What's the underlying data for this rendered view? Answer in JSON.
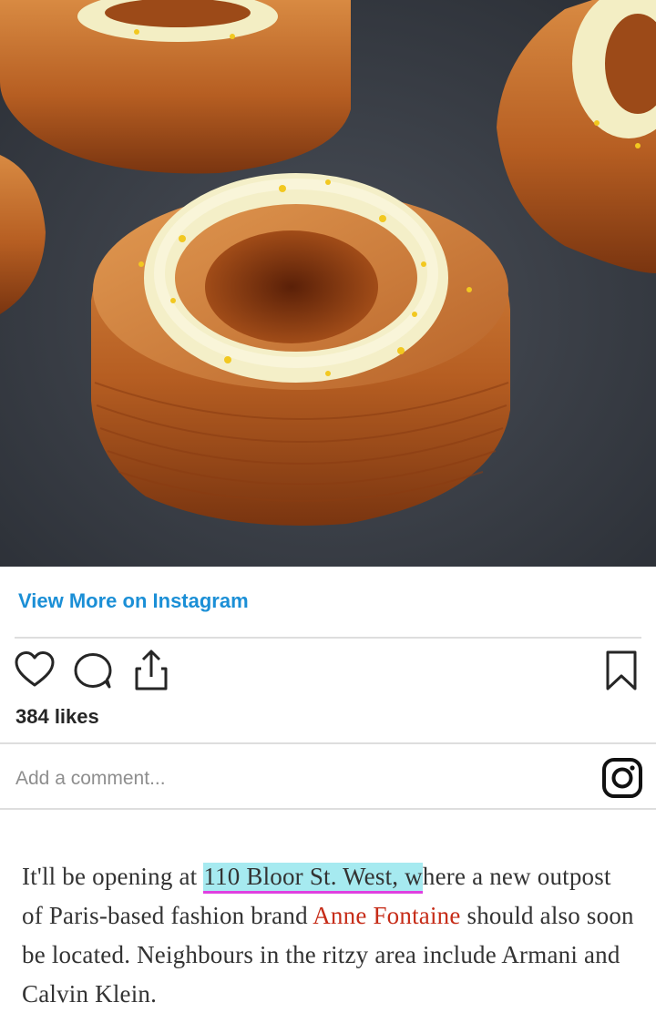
{
  "post": {
    "image_name": "cruffin-pastry-photo",
    "view_more_label": "View More on Instagram",
    "likes": "384 likes",
    "comment_placeholder": "Add a comment..."
  },
  "icons": {
    "like": "heart-icon",
    "comment": "comment-bubble-icon",
    "share": "share-upload-icon",
    "save": "bookmark-icon",
    "instagram": "instagram-logo-icon"
  },
  "colors": {
    "link_blue": "#1b8fd6",
    "link_red": "#c62c18",
    "highlight": "#a6eaf0",
    "underline": "#e040e0",
    "text": "#333333"
  },
  "article": {
    "part1": "It'll be opening at ",
    "highlight": "110 Bloor St. West, w",
    "part2": "here a new outpost of Paris-based fashion brand ",
    "link": "Anne Fontaine",
    "part3": " should also soon be located. Neighbours in the ritzy area include Armani and Calvin Klein."
  }
}
